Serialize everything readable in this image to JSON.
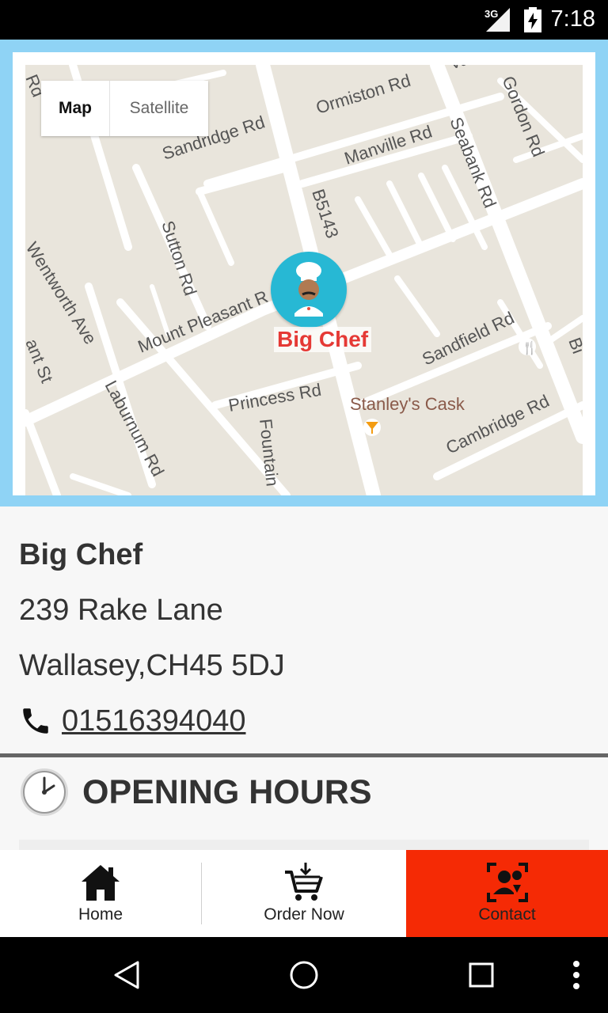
{
  "status_bar": {
    "network": "3G",
    "time": "7:18"
  },
  "map": {
    "toggle": {
      "map_label": "Map",
      "satellite_label": "Satellite"
    },
    "marker_label": "Big Chef",
    "street_labels": {
      "ormiston": "Ormiston Rd",
      "sandridge": "Sandridge Rd",
      "manville": "Manville Rd",
      "seabank": "Seabank Rd",
      "gordon": "Gordon Rd",
      "b5143": "B5143",
      "sutton": "Sutton Rd",
      "mount_pleasant": "Mount Pleasant R",
      "wentworth": "Wentworth Ave",
      "sandfield": "Sandfield Rd",
      "princess": "Princess Rd",
      "laburnum": "Laburnum Rd",
      "fountain": "Fountain",
      "stanleys": "Stanley's Cask",
      "cambridge": "Cambridge Rd",
      "ant_st": "ant St",
      "rd_top_left": "Rd",
      "vau": "Vau",
      "bi": "Bi"
    }
  },
  "restaurant": {
    "name": "Big Chef",
    "address_line1": "239 Rake Lane",
    "address_line2": "Wallasey,CH45 5DJ",
    "phone": "01516394040"
  },
  "opening_hours": {
    "title": "OPENING HOURS"
  },
  "bottom_nav": {
    "items": [
      {
        "label": "Home",
        "icon": "home-icon"
      },
      {
        "label": "Order Now",
        "icon": "cart-icon"
      },
      {
        "label": "Contact",
        "icon": "contact-icon"
      }
    ],
    "active_color": "#f52a05"
  },
  "colors": {
    "map_frame": "#8fd3f5",
    "marker": "#27b8d4",
    "marker_label": "#e53935"
  }
}
